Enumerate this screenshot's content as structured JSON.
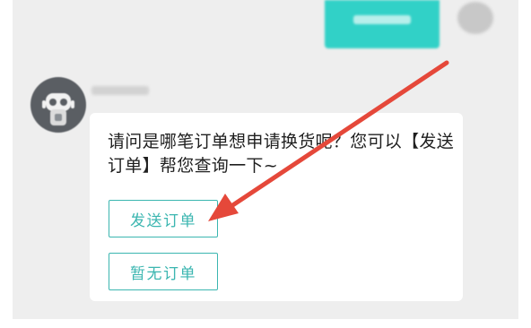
{
  "chat": {
    "bot_message": "请问是哪笔订单想申请换货呢？您可以【发送订单】帮您查询一下~",
    "buttons": {
      "send_order": "发送订单",
      "no_order": "暂无订单"
    }
  },
  "colors": {
    "accent": "#3bb6b0",
    "user_bubble": "#31d1c7",
    "annotation_arrow": "#e5483a",
    "background": "#eeeeee"
  },
  "icons": {
    "bot_avatar": "robot-icon",
    "annotation": "arrow-icon"
  }
}
